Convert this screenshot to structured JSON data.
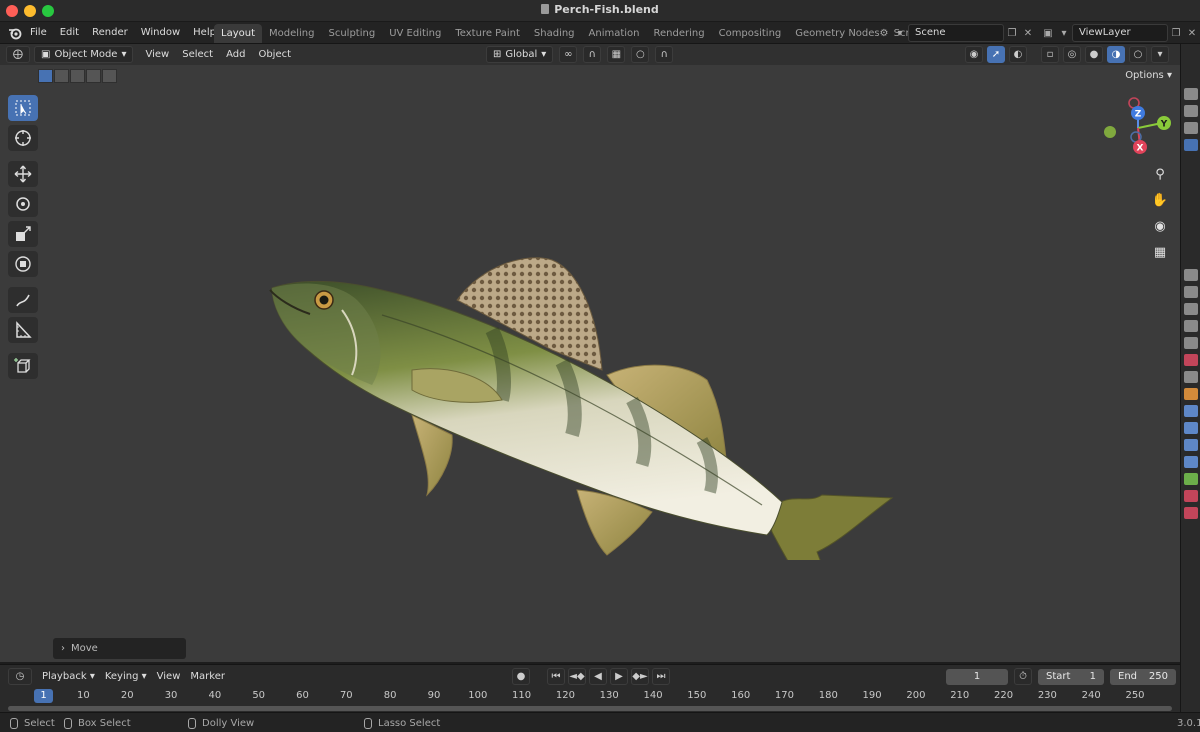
{
  "window": {
    "title": "Perch-Fish.blend"
  },
  "topmenu": {
    "items": [
      "File",
      "Edit",
      "Render",
      "Window",
      "Help"
    ]
  },
  "workspaces": {
    "tabs": [
      "Layout",
      "Modeling",
      "Sculpting",
      "UV Editing",
      "Texture Paint",
      "Shading",
      "Animation",
      "Rendering",
      "Compositing",
      "Geometry Nodes",
      "Scripting"
    ],
    "active": "Layout"
  },
  "scene": {
    "name": "Scene",
    "view_layer": "ViewLayer"
  },
  "viewport_header": {
    "mode": "Object Mode",
    "menus": [
      "View",
      "Select",
      "Add",
      "Object"
    ],
    "transform_orientation": "Global"
  },
  "viewport": {
    "options_label": "Options",
    "last_operator": "Move",
    "gizmo_axes": {
      "z": "Z",
      "y": "Y",
      "x": "X"
    }
  },
  "timeline": {
    "menus": [
      "Playback",
      "Keying",
      "View",
      "Marker"
    ],
    "current_frame": "1",
    "start_label": "Start",
    "start_value": "1",
    "end_label": "End",
    "end_value": "250",
    "ruler_marks": [
      "1",
      "10",
      "20",
      "30",
      "40",
      "50",
      "60",
      "70",
      "80",
      "90",
      "100",
      "110",
      "120",
      "130",
      "140",
      "150",
      "160",
      "170",
      "180",
      "190",
      "200",
      "210",
      "220",
      "230",
      "240",
      "250"
    ]
  },
  "statusbar": {
    "select": "Select",
    "box_select": "Box Select",
    "dolly_view": "Dolly View",
    "lasso_select": "Lasso Select",
    "version": "3.0.1"
  },
  "colors": {
    "accent": "#4772b3",
    "viewport_bg": "#3b3b3b"
  }
}
